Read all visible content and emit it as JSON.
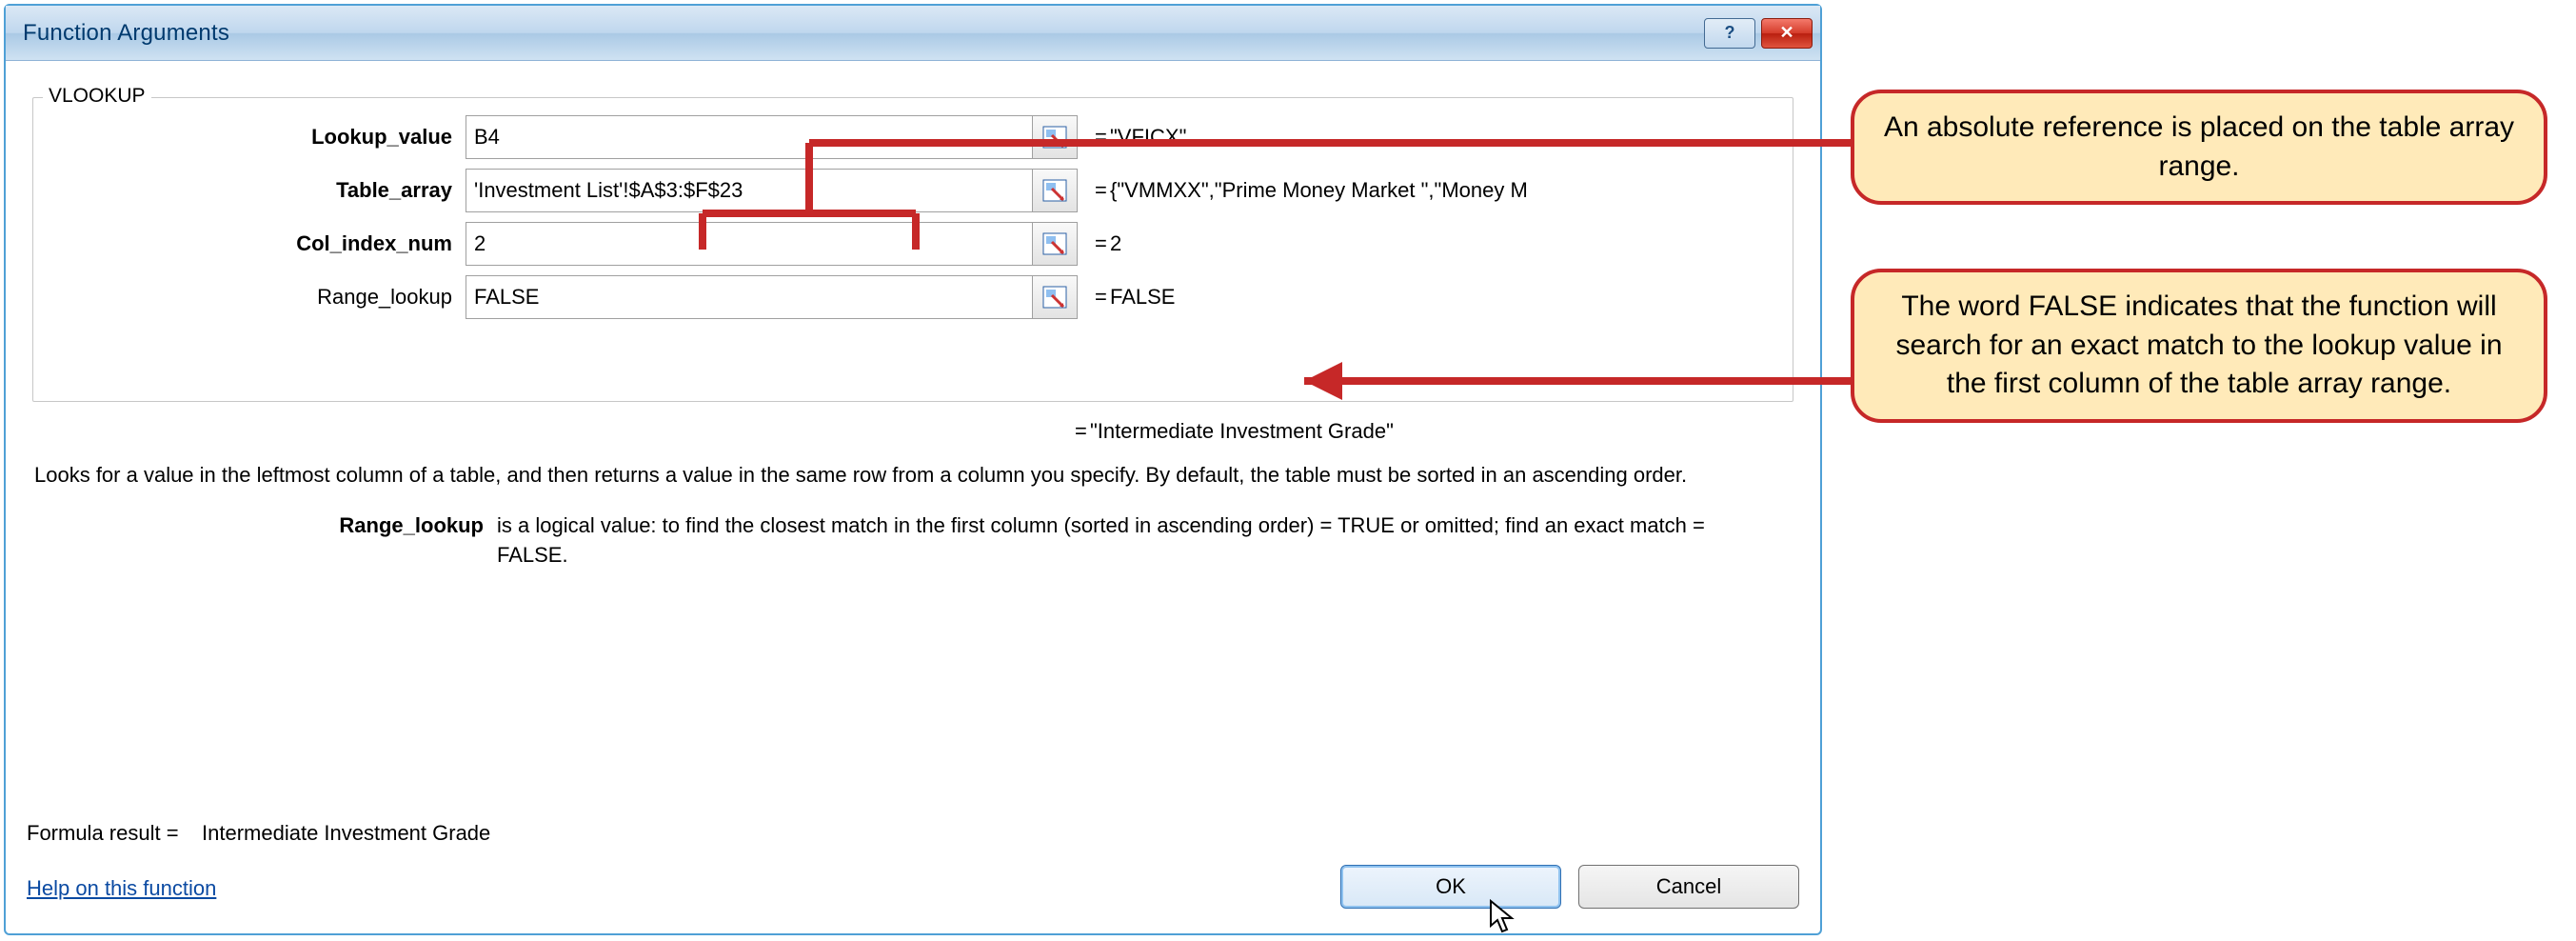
{
  "dialog": {
    "title": "Function Arguments",
    "function_name": "VLOOKUP",
    "args": [
      {
        "label": "Lookup_value",
        "bold": true,
        "value": "B4",
        "evaluated": "\"VFICX\""
      },
      {
        "label": "Table_array",
        "bold": true,
        "value": "'Investment List'!$A$3:$F$23",
        "evaluated": "{\"VMMXX\",\"Prime Money Market \",\"Money M"
      },
      {
        "label": "Col_index_num",
        "bold": true,
        "value": "2",
        "evaluated": "2"
      },
      {
        "label": "Range_lookup",
        "bold": false,
        "value": "FALSE",
        "evaluated": "FALSE"
      }
    ],
    "formula_evaluated": "\"Intermediate Investment Grade\"",
    "description": "Looks for a value in the leftmost column of a table, and then returns a value in the same row from a column you specify. By default, the table must be sorted in an ascending order.",
    "selected_arg": {
      "name": "Range_lookup",
      "desc": "is a logical value: to find the closest match in the first column (sorted in ascending order) = TRUE or omitted; find an exact match = FALSE."
    },
    "formula_result_label": "Formula result =",
    "formula_result_value": "Intermediate Investment Grade",
    "help_link": "Help on this function",
    "buttons": {
      "ok": "OK",
      "cancel": "Cancel"
    }
  },
  "callouts": {
    "top": "An absolute reference is placed on the table array range.",
    "bottom": "The word FALSE indicates that the function will search for an exact match to the lookup value in the first column of the table array range."
  }
}
